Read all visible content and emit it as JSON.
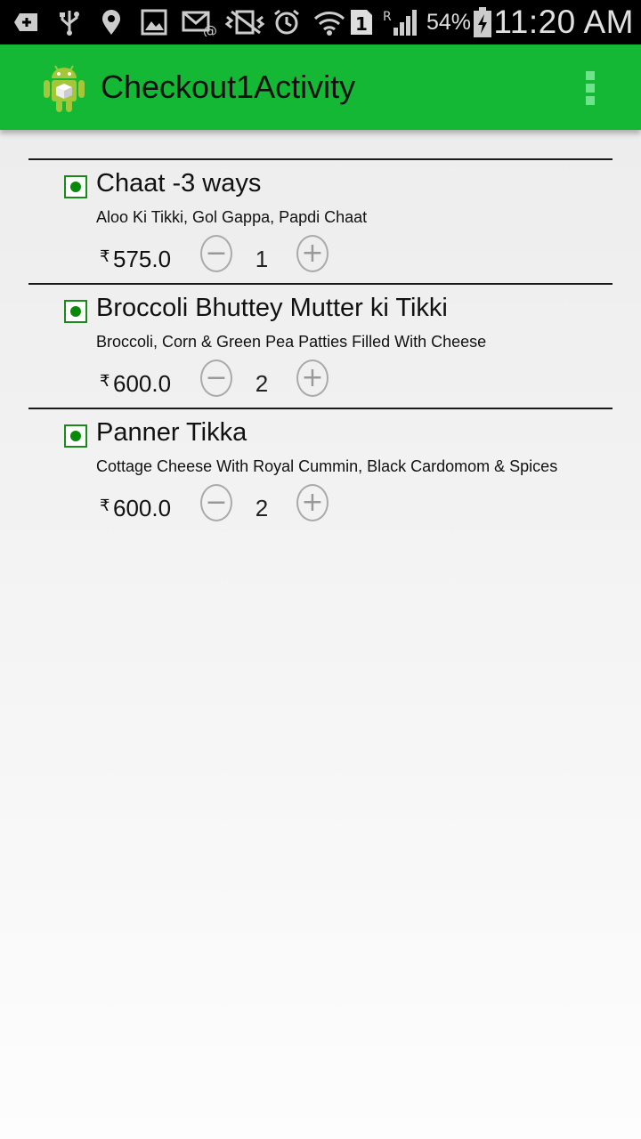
{
  "status_bar": {
    "battery_percent": "54%",
    "time": "11:20 AM",
    "network_label": "R",
    "sim_label": "1",
    "icons": [
      "add-icon",
      "usb-icon",
      "location-icon",
      "image-icon",
      "email-icon",
      "vibrate-icon",
      "alarm-icon",
      "wifi-icon",
      "sim-icon",
      "signal-icon",
      "battery-icon"
    ]
  },
  "action_bar": {
    "title": "Checkout1Activity",
    "brand_color": "#15b835"
  },
  "items": [
    {
      "name": "Chaat -3 ways",
      "description": "Aloo Ki Tikki, Gol Gappa, Papdi Chaat",
      "currency": "₹",
      "price": "575.0",
      "quantity": "1"
    },
    {
      "name": "Broccoli Bhuttey Mutter ki Tikki",
      "description": "Broccoli, Corn & Green Pea Patties Filled With Cheese",
      "currency": "₹",
      "price": "600.0",
      "quantity": "2"
    },
    {
      "name": "Panner Tikka",
      "description": "Cottage Cheese With Royal Cummin, Black Cardomom & Spices",
      "currency": "₹",
      "price": "600.0",
      "quantity": "2"
    }
  ],
  "controls": {
    "decrement_glyph": "−",
    "increment_glyph": "+"
  }
}
